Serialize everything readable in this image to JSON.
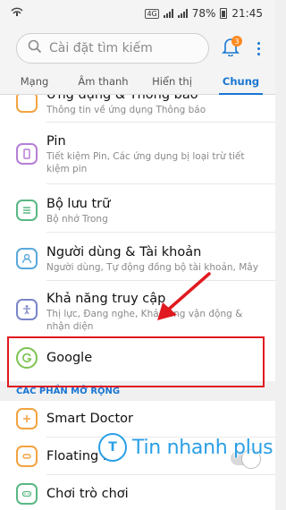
{
  "status_bar": {
    "left_icon": "signal-wifi-icon",
    "network": "4G",
    "battery": "78%",
    "time": "21:45"
  },
  "search": {
    "placeholder": "Cài đặt tìm kiếm"
  },
  "notifications": {
    "count": "3"
  },
  "tabs": [
    {
      "label": "Mạng",
      "active": false
    },
    {
      "label": "Âm thanh",
      "active": false
    },
    {
      "label": "Hiển thị",
      "active": false
    },
    {
      "label": "Chung",
      "active": true
    }
  ],
  "items": [
    {
      "title": "Ứng dụng & Thông báo",
      "desc": "Thông tin về ứng dụng Thông báo",
      "icon": "apps-icon",
      "color": "#f2a341"
    },
    {
      "title": "Pin",
      "desc": "Tiết kiệm Pin, Các ứng dụng bị loại trừ tiết kiệm pin",
      "icon": "battery-icon",
      "color": "#b57fd6"
    },
    {
      "title": "Bộ lưu trữ",
      "desc": "Bộ nhớ Trong",
      "icon": "storage-icon",
      "color": "#59b884"
    },
    {
      "title": "Người dùng & Tài khoản",
      "desc": "Người dùng, Tự động đồng bộ tài khoản, Mây",
      "icon": "user-icon",
      "color": "#5aa9dd"
    },
    {
      "title": "Khả năng truy cập",
      "desc": "Thị lực, Đang nghe, Khả năng vận động & nhận diện",
      "icon": "accessibility-icon",
      "color": "#7a86c9"
    },
    {
      "title": "Google",
      "desc": "",
      "icon": "google-icon",
      "color": "#7cc24f"
    }
  ],
  "section_header": "CÁC PHẦN MỞ RỘNG",
  "extensions": [
    {
      "title": "Smart Doctor",
      "icon": "smart-doctor-icon",
      "color": "#f2a341"
    },
    {
      "title": "Floating Ba",
      "icon": "floating-bar-icon",
      "color": "#f2a341"
    },
    {
      "title": "Chơi trò chơi",
      "icon": "game-icon",
      "color": "#59b884"
    }
  ],
  "watermark": {
    "logo_letter": "T",
    "text": "Tin nhanh plus"
  },
  "colors": {
    "accent": "#1976d2",
    "highlight_box": "#e0191f"
  }
}
